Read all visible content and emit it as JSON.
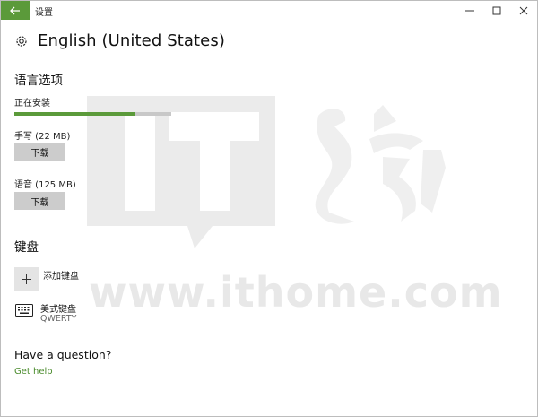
{
  "window": {
    "title": "设置"
  },
  "page": {
    "title": "English (United States)"
  },
  "language_options": {
    "section_title": "语言选项",
    "installing_label": "正在安装",
    "install_progress_percent": 77,
    "handwriting_label": "手写 (22 MB)",
    "handwriting_button": "下载",
    "speech_label": "语音 (125 MB)",
    "speech_button": "下载"
  },
  "keyboard": {
    "section_title": "键盘",
    "add_label": "添加键盘",
    "items": [
      {
        "name": "美式键盘",
        "layout": "QWERTY"
      }
    ]
  },
  "help": {
    "question": "Have a question?",
    "link": "Get help"
  },
  "watermark": {
    "url": "www.ithome.com"
  },
  "colors": {
    "accent": "#5b9a3a",
    "link": "#4a8b2c",
    "button": "#cccccc"
  },
  "icons": [
    "back-arrow-icon",
    "minimize-icon",
    "maximize-icon",
    "close-icon",
    "gear-icon",
    "plus-icon",
    "keyboard-icon"
  ]
}
